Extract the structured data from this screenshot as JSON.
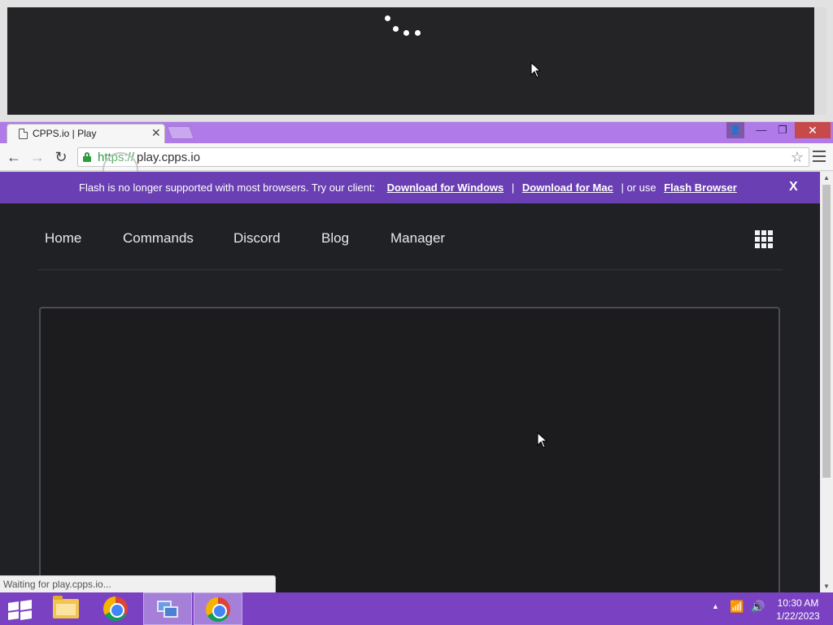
{
  "background_window": {
    "loader_dots": 4
  },
  "browser": {
    "tab": {
      "title": "CPPS.io | Play",
      "close_label": "✕"
    },
    "window_controls": {
      "user": "👤",
      "minimize": "—",
      "maximize": "❐",
      "close": "✕"
    },
    "toolbar": {
      "back": "←",
      "forward": "→",
      "reload": "↻",
      "url_scheme": "https://",
      "url_rest": "play.cpps.io",
      "bookmark": "☆"
    }
  },
  "banner": {
    "message": "Flash is no longer supported with most browsers. Try our client:",
    "link_windows": "Download for Windows",
    "sep1": "|",
    "link_mac": "Download for Mac",
    "or_use": "| or use",
    "link_flash": "Flash Browser",
    "close": "X"
  },
  "nav": {
    "items": [
      {
        "label": "Home"
      },
      {
        "label": "Commands"
      },
      {
        "label": "Discord"
      },
      {
        "label": "Blog"
      },
      {
        "label": "Manager"
      }
    ],
    "apps_icon": "grid-icon"
  },
  "status_bar": {
    "text": "Waiting for play.cpps.io..."
  },
  "taskbar": {
    "items": [
      {
        "name": "start",
        "icon": "windows-logo-icon"
      },
      {
        "name": "file-explorer",
        "icon": "folder-icon"
      },
      {
        "name": "chrome",
        "icon": "chrome-icon"
      },
      {
        "name": "network-app",
        "icon": "network-icon",
        "active": true
      },
      {
        "name": "chrome-active",
        "icon": "chrome-icon",
        "active": true
      }
    ],
    "tray": {
      "expand": "▲",
      "network": "📶",
      "volume": "🔊"
    },
    "clock": {
      "time": "10:30 AM",
      "date": "1/22/2023"
    }
  },
  "colors": {
    "accent_purple": "#7a42c2",
    "banner_purple": "#6a3fb3",
    "page_bg": "#202124",
    "secure_green": "#2e9b3d"
  }
}
